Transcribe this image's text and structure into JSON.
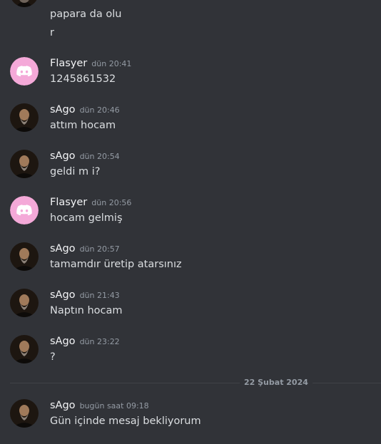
{
  "continuation": {
    "lines": [
      "papara da olu",
      "r"
    ]
  },
  "messages": [
    {
      "user": "Flasyer",
      "time": "dün 20:41",
      "text": "1245861532",
      "avatar": "discord-logo-icon"
    },
    {
      "user": "sAgo",
      "time": "dün 20:46",
      "text": "attım hocam",
      "avatar": "portrait-icon"
    },
    {
      "user": "sAgo",
      "time": "dün 20:54",
      "text": "geldi m i?",
      "avatar": "portrait-icon"
    },
    {
      "user": "Flasyer",
      "time": "dün 20:56",
      "text": "hocam gelmiş",
      "avatar": "discord-logo-icon"
    },
    {
      "user": "sAgo",
      "time": "dün 20:57",
      "text": "tamamdır üretip atarsınız",
      "avatar": "portrait-icon"
    },
    {
      "user": "sAgo",
      "time": "dün 21:43",
      "text": "Naptın hocam",
      "avatar": "portrait-icon"
    },
    {
      "user": "sAgo",
      "time": "dün 23:22",
      "text": "?",
      "avatar": "portrait-icon"
    },
    {
      "user": "sAgo",
      "time": "bugün saat 09:18",
      "text": "Gün içinde mesaj bekliyorum",
      "avatar": "portrait-icon"
    }
  ],
  "date_divider": "22 Şubat 2024",
  "colors": {
    "background": "#313338",
    "discord_avatar_bg": "#f4a9d8",
    "portrait_bg": "#2a2018"
  }
}
